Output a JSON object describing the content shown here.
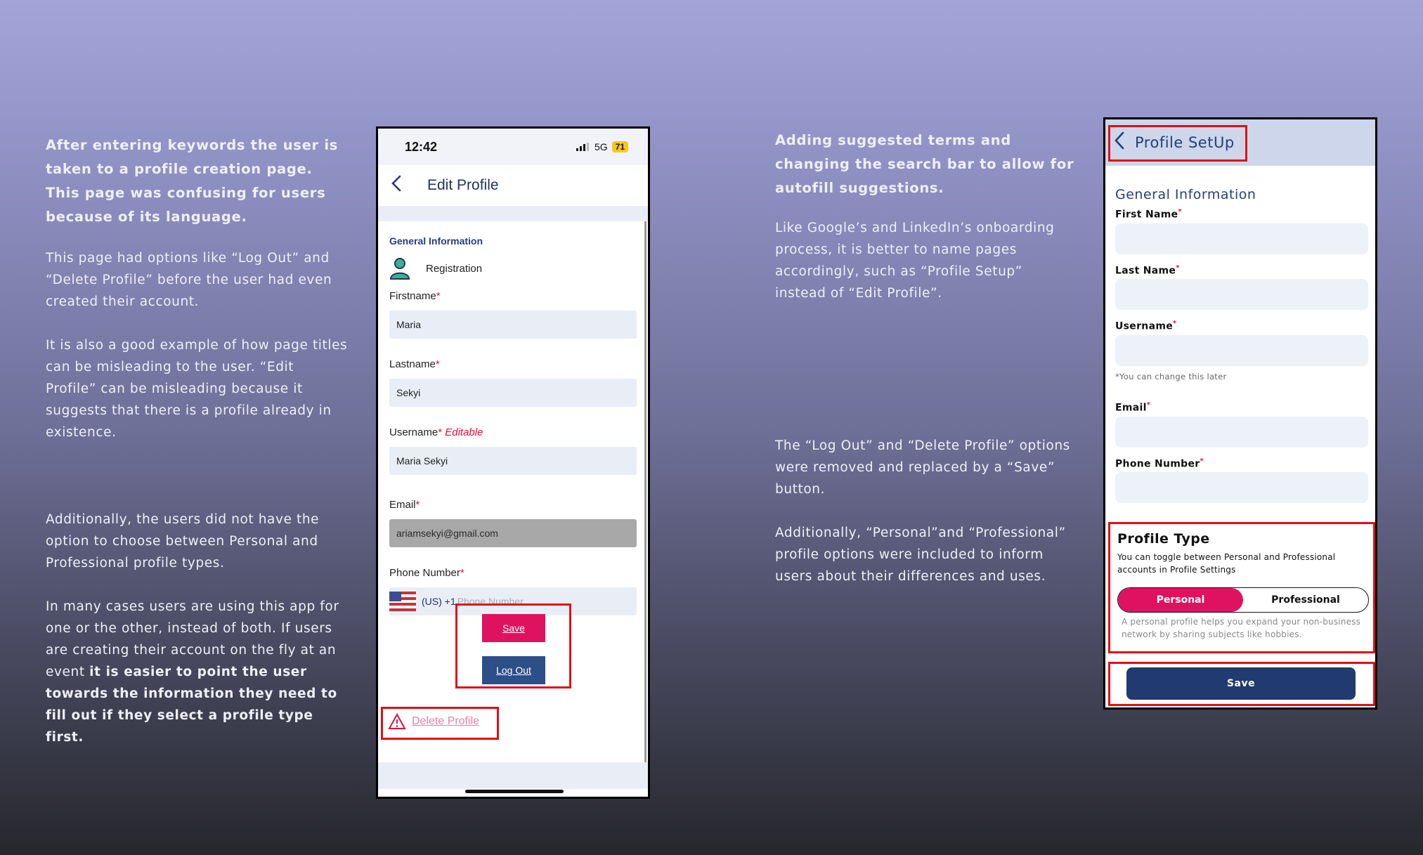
{
  "left_text": {
    "heading": "After entering keywords the user is taken to a profile creation page. This page was confusing for users because of its language.",
    "p1": "This page had options like “Log Out” and “Delete Profile” before the user had even created their account.",
    "p2": "It is also a good example of how page titles can be misleading to the user. “Edit Profile” can be misleading because it suggests that there is a profile already in existence.",
    "p3": "Additionally, the users did not have the option to choose between Personal and Professional profile types.",
    "p4_plain": "In many cases users are using this app for one or the other, instead of both. If users are creating their account on the fly at an event ",
    "p4_bold": "it is easier to point the user towards the information they need to fill out if they select a profile type first."
  },
  "phone1": {
    "time": "12:42",
    "network": "5G",
    "battery": "71",
    "title": "Edit Profile",
    "section": "General Information",
    "registration": "Registration",
    "fields": {
      "firstname_label": "Firstname",
      "firstname_value": "Maria",
      "lastname_label": "Lastname",
      "lastname_value": "Sekyi",
      "username_label": "Username",
      "username_tag": "Editable",
      "username_value": "Maria Sekyi",
      "email_label": "Email",
      "email_value": "ariamsekyi@gmail.com",
      "phone_label": "Phone Number",
      "phone_code": "(US) +1",
      "phone_placeholder": "Phone Number"
    },
    "required_mark": "*",
    "save": "Save",
    "logout": "Log Out",
    "delete": "Delete Profile"
  },
  "mid_text": {
    "heading": "Adding suggested terms and changing the search bar to allow for autofill suggestions.",
    "p1": "Like Google’s and LinkedIn’s onboarding process, it is better to name pages accordingly, such as “Profile Setup” instead of “Edit Profile”.",
    "p2": "The “Log Out” and “Delete Profile” options were removed and replaced by a “Save” button.",
    "p3": "Additionally, “Personal”and “Professional” profile options were included to inform users about their differences and uses."
  },
  "phone2": {
    "title": "Profile SetUp",
    "section": "General Information",
    "first_name": "First Name",
    "last_name": "Last Name",
    "username": "Username",
    "username_hint": "*You can change this later",
    "email": "Email",
    "phone": "Phone Number",
    "required_mark": "*",
    "profile_type": "Profile Type",
    "profile_type_desc": "You can toggle between Personal and Professional accounts in Profile Settings",
    "toggle_personal": "Personal",
    "toggle_professional": "Professional",
    "personal_note": "A personal profile helps you expand your non-business network by sharing subjects like hobbies.",
    "save": "Save"
  },
  "colors": {
    "accent_pink": "#df1260",
    "navy": "#213a6f",
    "highlight_red": "#e10f17"
  }
}
